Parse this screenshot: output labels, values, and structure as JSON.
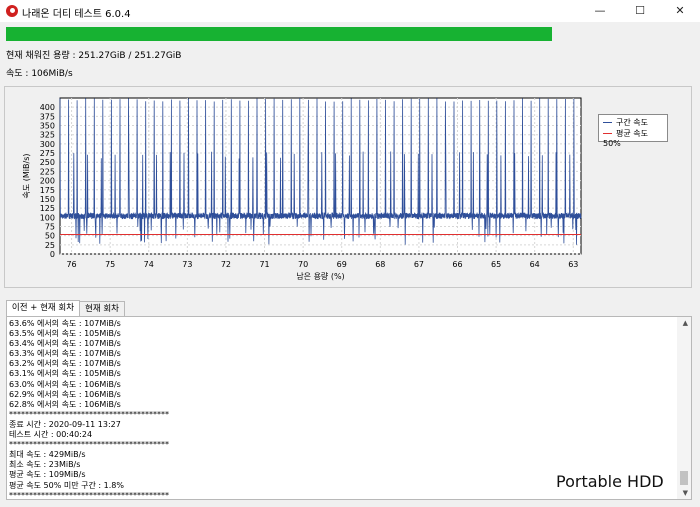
{
  "window": {
    "title": "나래온 더티 테스트 6.0.4",
    "minimize": "—",
    "maximize": "☐",
    "close": "✕"
  },
  "progress": {
    "fraction": 1.0,
    "color": "#17b232"
  },
  "info": {
    "filled": "현재 채워진 용량 : 251.27GiB / 251.27GiB",
    "speed": "속도 : 106MiB/s"
  },
  "chart_data": {
    "type": "line",
    "xlabel": "남은 용량 (%)",
    "ylabel": "속도 (MiB/s)",
    "xlim": [
      76.3,
      62.8
    ],
    "ylim": [
      0,
      425
    ],
    "x_ticks": [
      "76",
      "75",
      "74",
      "73",
      "72",
      "71",
      "70",
      "69",
      "68",
      "67",
      "66",
      "65",
      "64",
      "63"
    ],
    "y_ticks": [
      "0",
      "25",
      "50",
      "75",
      "100",
      "125",
      "150",
      "175",
      "200",
      "225",
      "250",
      "275",
      "300",
      "325",
      "350",
      "375",
      "400"
    ],
    "series": [
      {
        "name": "구간 속도",
        "color": "#2f4f9a",
        "baseline": 107,
        "low": 95,
        "spike_max": 425,
        "spike_mid": 260,
        "dip_min": 25
      },
      {
        "name": "평균 속도 50%",
        "color": "#e03030",
        "value": 53
      }
    ],
    "legend_position": "right",
    "grid": true
  },
  "tabs": [
    {
      "label": "이전 + 현재 회차",
      "active": true
    },
    {
      "label": "현재 회차",
      "active": false
    }
  ],
  "log_lines": [
    "63.6% 에서의 속도 : 107MiB/s",
    "63.5% 에서의 속도 : 105MiB/s",
    "63.4% 에서의 속도 : 107MiB/s",
    "63.3% 에서의 속도 : 107MiB/s",
    "63.2% 에서의 속도 : 107MiB/s",
    "63.1% 에서의 속도 : 105MiB/s",
    "63.0% 에서의 속도 : 106MiB/s",
    "62.9% 에서의 속도 : 106MiB/s",
    "62.8% 에서의 속도 : 106MiB/s",
    "****************************************",
    "종료 시간 : 2020-09-11 13:27",
    "테스트 시간 : 00:40:24",
    "****************************************",
    "최대 속도 : 429MiB/s",
    "최소 속도 : 23MiB/s",
    "평균 속도 : 109MiB/s",
    "평균 속도 50% 미만 구간 : 1.8%",
    "****************************************"
  ],
  "watermark": "Portable HDD"
}
